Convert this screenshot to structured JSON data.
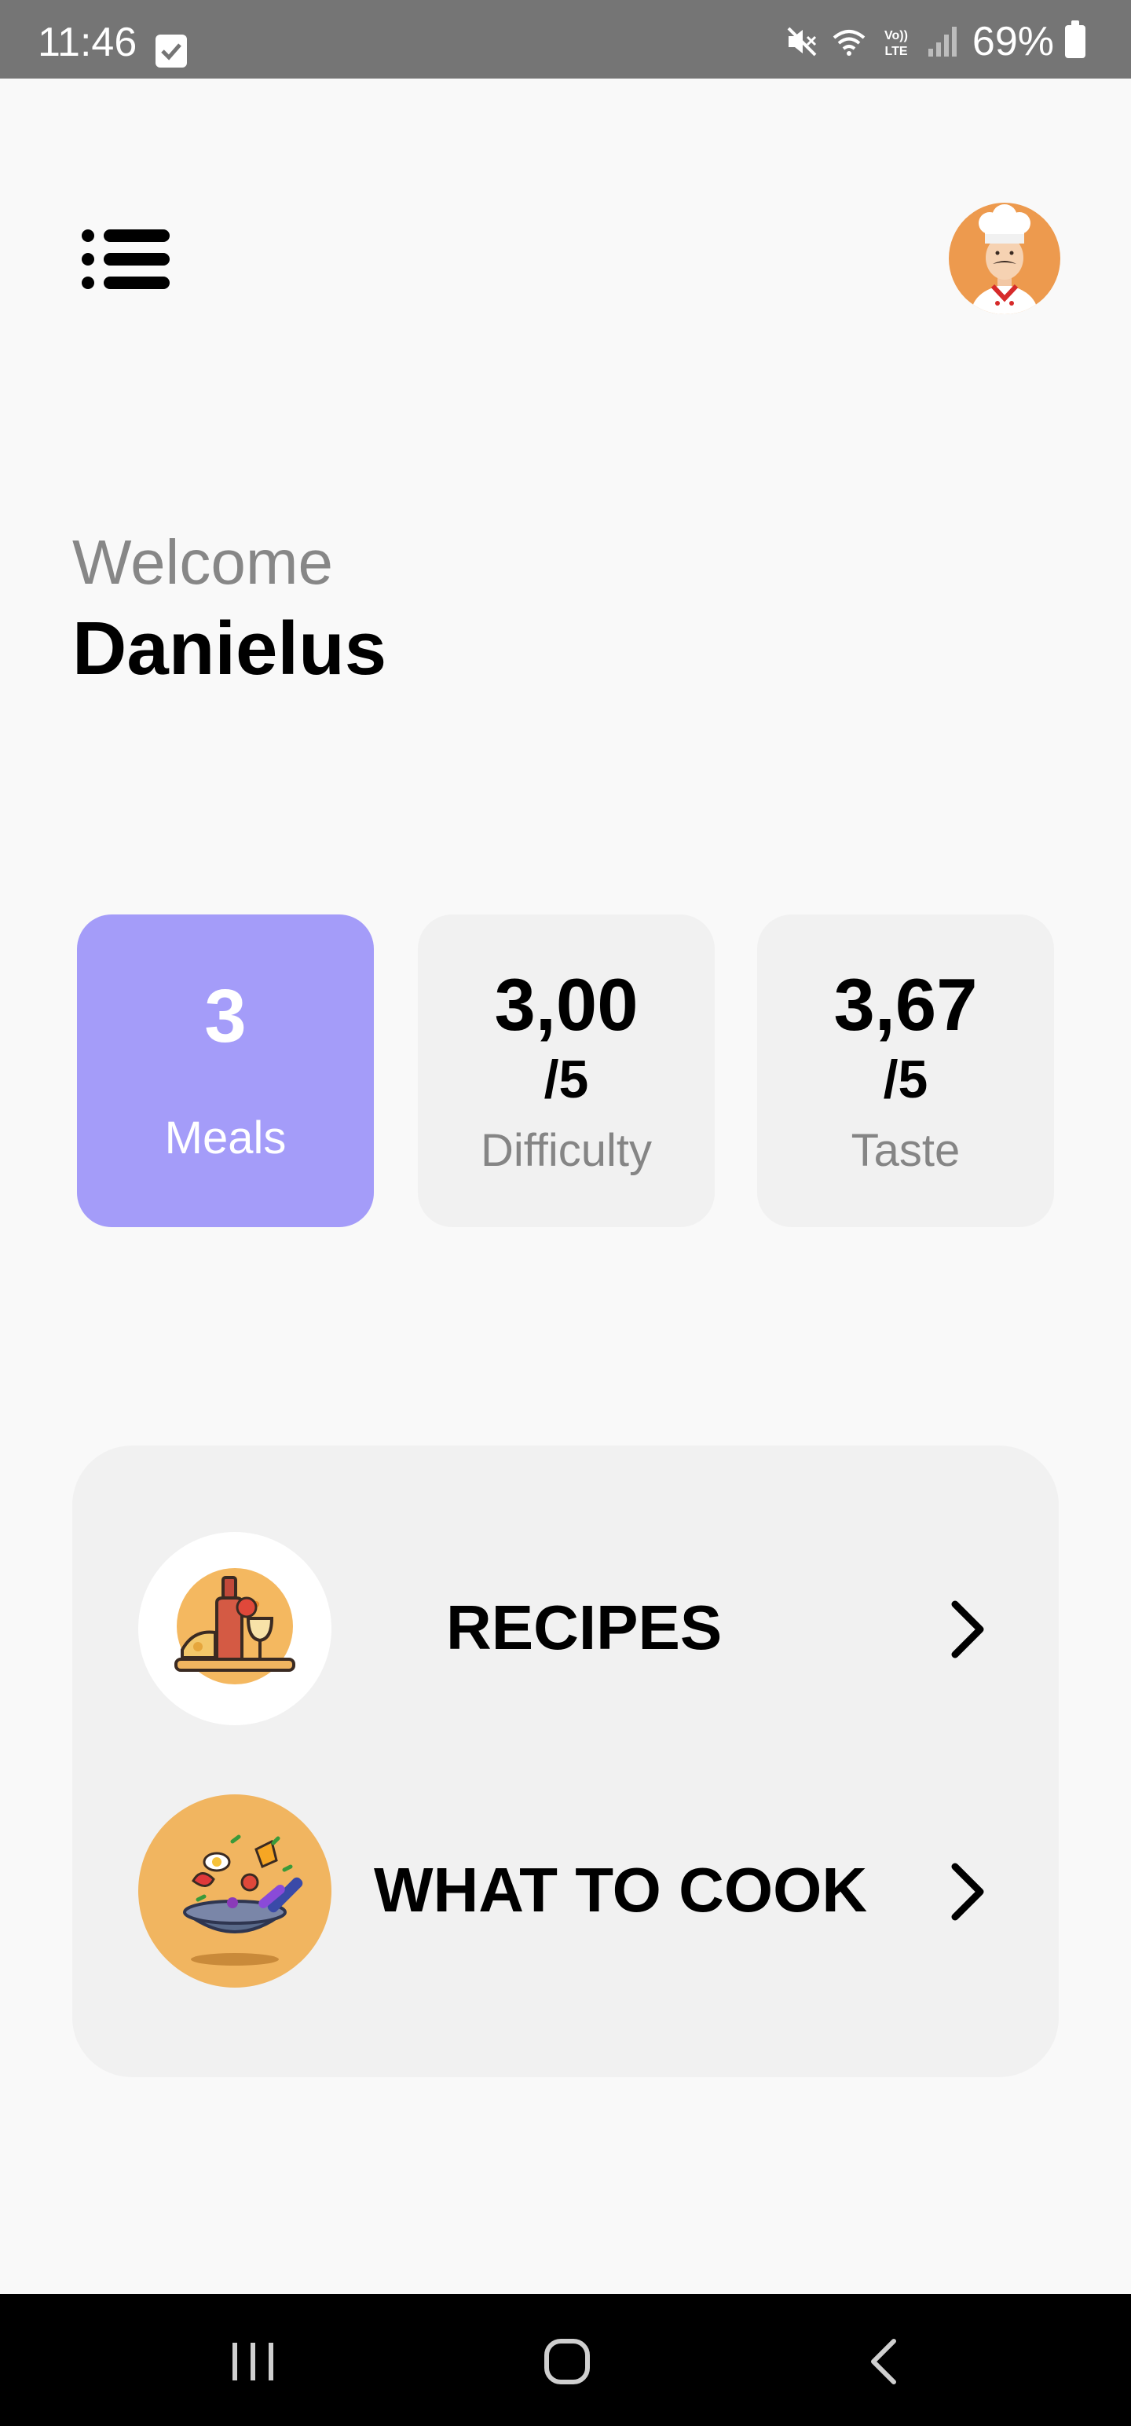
{
  "status_bar": {
    "time": "11:46",
    "battery": "69%"
  },
  "header": {
    "menu_icon": "list-menu-icon",
    "avatar_icon": "chef-avatar"
  },
  "welcome": {
    "greeting": "Welcome",
    "name": "Danielus"
  },
  "stats": {
    "meals": {
      "value": "3",
      "label": "Meals"
    },
    "difficulty": {
      "value": "3,00",
      "scale": "/5",
      "label": "Difficulty"
    },
    "taste": {
      "value": "3,67",
      "scale": "/5",
      "label": "Taste"
    }
  },
  "actions": [
    {
      "label": "RECIPES",
      "icon": "recipes-illustration"
    },
    {
      "label": "WHAT TO COOK",
      "icon": "pan-illustration"
    }
  ],
  "colors": {
    "accent": "#a49cf9",
    "card": "#f1f1f1",
    "background": "#f9f9f9",
    "avatar_bg": "#ed9a4e",
    "cook_thumb_bg": "#f1b560"
  }
}
